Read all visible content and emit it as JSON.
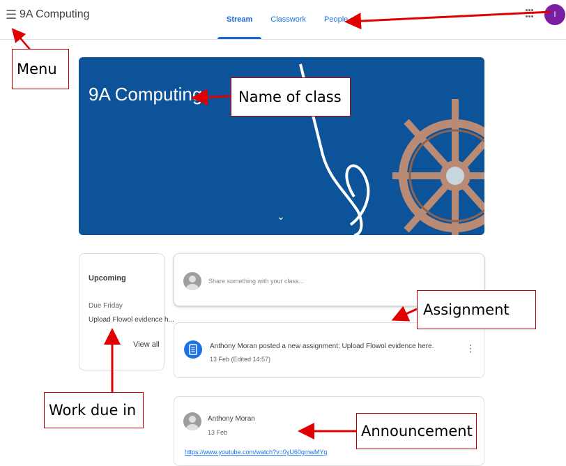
{
  "header": {
    "menu_icon": "menu-icon",
    "class_name": "9A Computing",
    "tabs": [
      {
        "label": "Stream",
        "active": true
      },
      {
        "label": "Classwork",
        "active": false
      },
      {
        "label": "People",
        "active": false
      }
    ],
    "apps_icon": "apps-grid-icon",
    "avatar_initial": "I",
    "avatar_color": "#7b1fa2"
  },
  "banner": {
    "title": "9A Computing",
    "chevron": "⌄",
    "background_color": "#0d5399"
  },
  "upcoming": {
    "title": "Upcoming",
    "due_label": "Due Friday",
    "item": "Upload Flowol evidence h...",
    "view_all": "View all"
  },
  "share": {
    "placeholder": "Share something with your class..."
  },
  "assignment_post": {
    "title": "Anthony Moran posted a new assignment: Upload Flowol evidence here.",
    "date": "13 Feb (Edited 14:57)"
  },
  "announcement_post": {
    "author": "Anthony Moran",
    "date": "13 Feb",
    "link": "https://www.youtube.com/watch?v=0yU60gmwMYg"
  },
  "annotations": {
    "menu": "Menu",
    "name_of_class": "Name of class",
    "assignment": "Assignment",
    "work_due_in": "Work due in",
    "announcement": "Announcement",
    "arrow_color": "#e00000"
  }
}
